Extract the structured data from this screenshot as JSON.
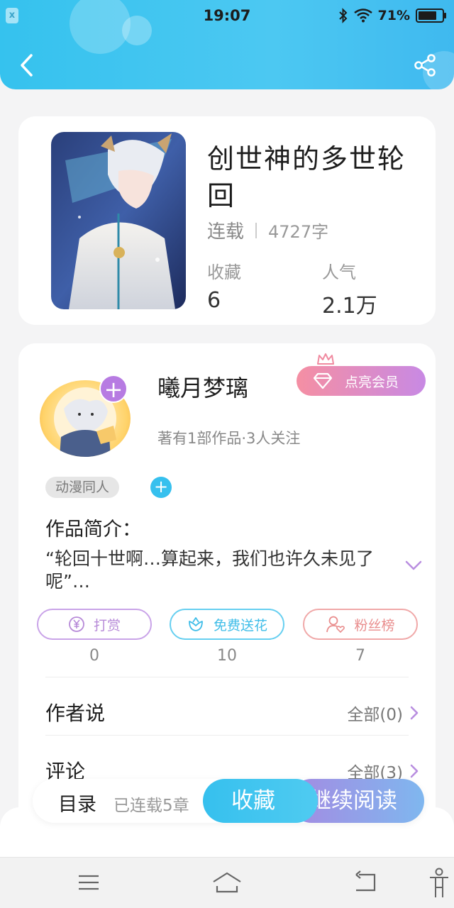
{
  "status_bar": {
    "time": "19:07",
    "battery": "71%",
    "icons": [
      "app-notification-icon",
      "bluetooth-icon",
      "wifi-icon",
      "battery-icon"
    ]
  },
  "header": {
    "back_icon": "chevron-left-icon",
    "share_icon": "share-icon",
    "gradient": [
      "#35c2ee",
      "#3fb9ef"
    ]
  },
  "book": {
    "title": "创世神的多世轮回",
    "status": "连载",
    "word_count": "4727字",
    "stats": [
      {
        "label": "收藏",
        "value": "6"
      },
      {
        "label": "人气",
        "value": "2.1万"
      }
    ]
  },
  "author": {
    "name": "曦月梦璃",
    "stats": "著有1部作品·3人关注",
    "follow_label": "+",
    "vip_label": "点亮会员",
    "tags": [
      "动漫同人"
    ],
    "tag_add_label": "+"
  },
  "intro": {
    "title": "作品简介：",
    "text": "“轮回十世啊…算起来，我们也许久未见了呢”…"
  },
  "actions": [
    {
      "label": "打赏",
      "count": "0",
      "icon": "yen-coin-icon",
      "color": "#b78ad8"
    },
    {
      "label": "免费送花",
      "count": "10",
      "icon": "flower-icon",
      "color": "#3fbde8"
    },
    {
      "label": "粉丝榜",
      "count": "7",
      "icon": "fan-user-heart-icon",
      "color": "#e98d8d"
    }
  ],
  "sections": [
    {
      "title": "作者说",
      "link": "全部(0)"
    },
    {
      "title": "评论",
      "link": "全部(3)"
    }
  ],
  "bottom_bar": {
    "toc_label": "目录",
    "chapters": "已连载5章",
    "collect_label": "收藏",
    "read_label": "继续阅读"
  },
  "colors": {
    "accent_blue": "#36c0ee",
    "accent_purple": "#b77be2",
    "vip_gradient": [
      "#f58fa3",
      "#c889e4"
    ]
  },
  "system_nav": [
    "menu-icon",
    "home-icon",
    "back-icon",
    "accessibility-icon"
  ]
}
